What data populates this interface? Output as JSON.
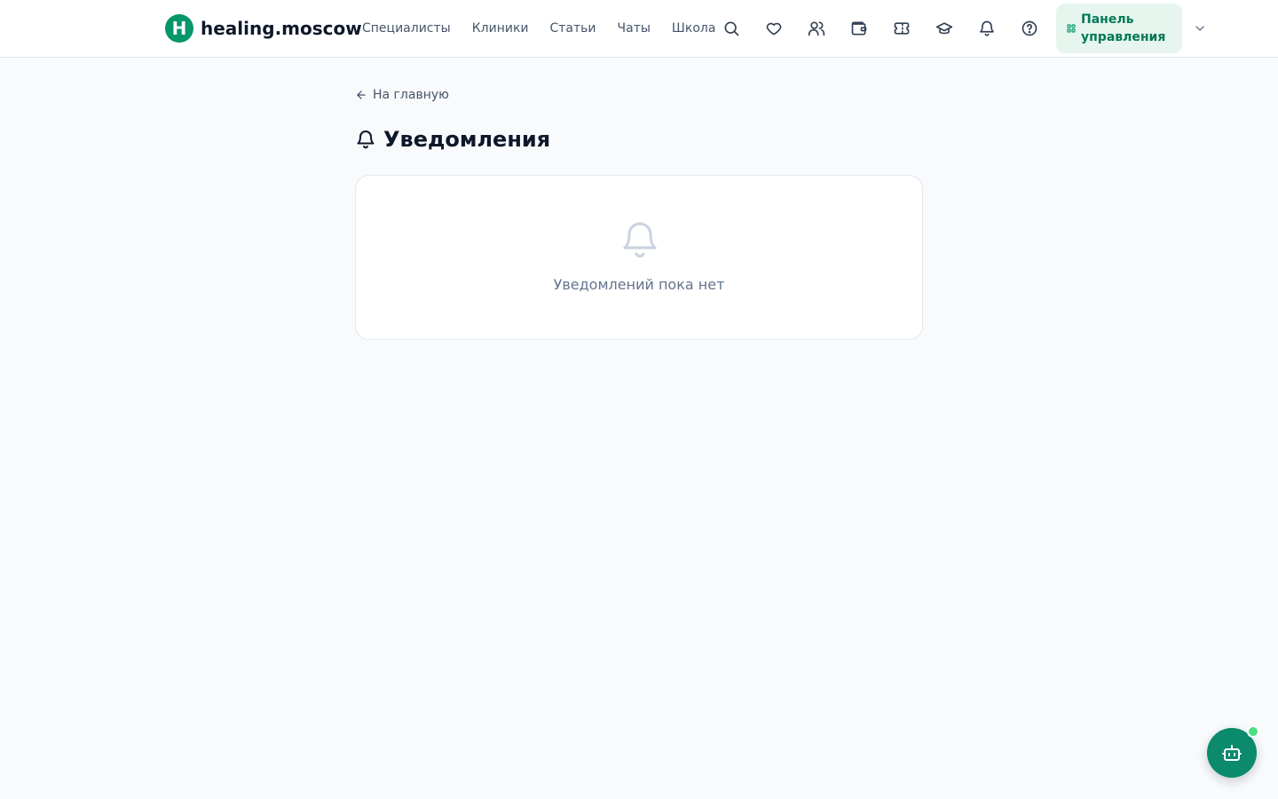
{
  "header": {
    "logo_letter": "H",
    "logo_text": "healing.moscow",
    "nav": [
      "Специалисты",
      "Клиники",
      "Статьи",
      "Чаты",
      "Школа"
    ],
    "icons": [
      "search-icon",
      "heart-icon",
      "users-icon",
      "wallet-icon",
      "ticket-icon",
      "graduation-cap-icon",
      "bell-icon",
      "help-icon"
    ],
    "dashboard_label": "Панель управления"
  },
  "main": {
    "back_link": "На главную",
    "title": "Уведомления",
    "empty_text": "Уведомлений пока нет"
  },
  "colors": {
    "brand": "#059669",
    "brand_light": "#e6f6ee",
    "page_bg": "#f8fafc",
    "bot_button": "#0b8a6c",
    "online_indicator": "#4ade80"
  }
}
